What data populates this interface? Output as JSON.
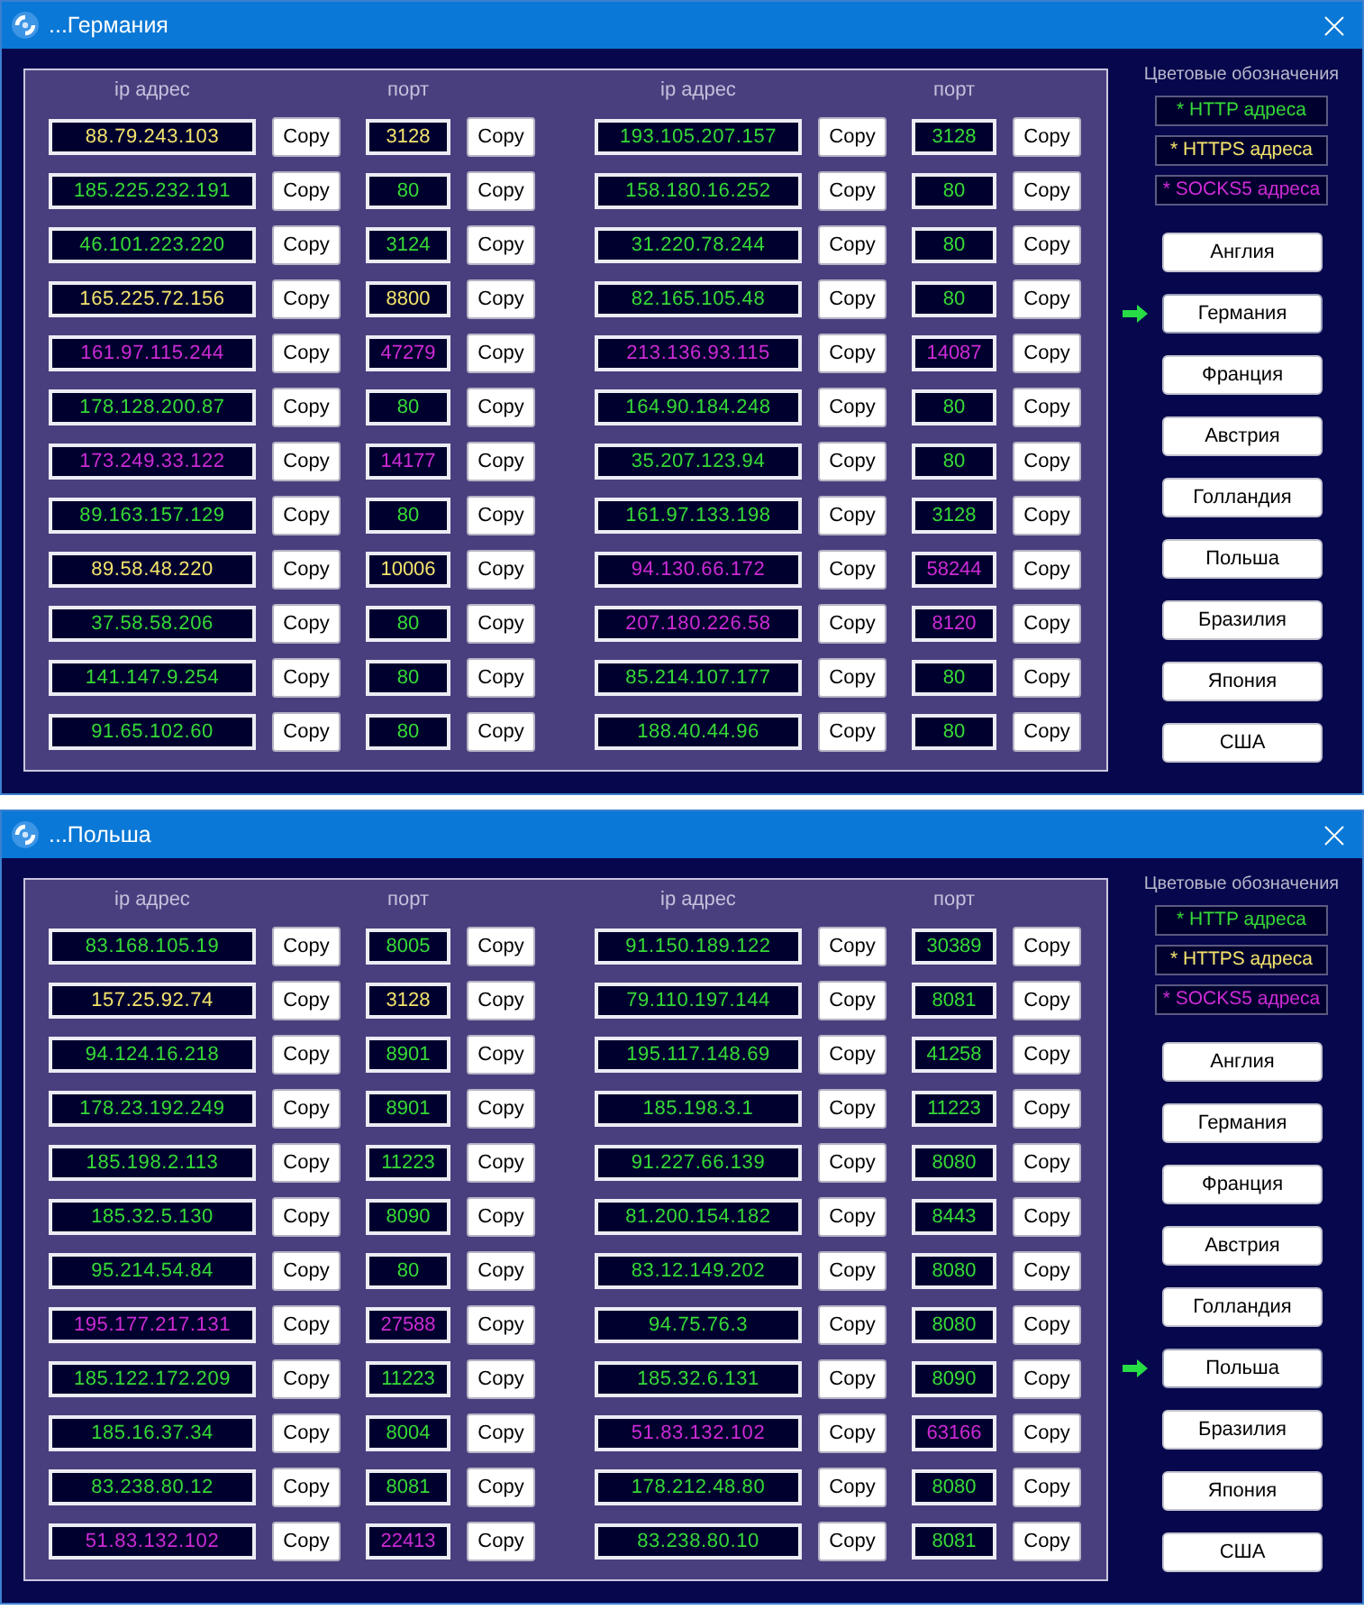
{
  "windows": [
    {
      "title": "...Германия",
      "groups": [
        {
          "ip_header": "ip адрес",
          "port_header": "порт",
          "rows": [
            {
              "ip": "88.79.243.103",
              "ip_button": "Copy",
              "port": "3128",
              "port_button": "Copy",
              "kind": "https"
            },
            {
              "ip": "185.225.232.191",
              "ip_button": "Copy",
              "port": "80",
              "port_button": "Copy",
              "kind": "http"
            },
            {
              "ip": "46.101.223.220",
              "ip_button": "Copy",
              "port": "3124",
              "port_button": "Copy",
              "kind": "http"
            },
            {
              "ip": "165.225.72.156",
              "ip_button": "Copy",
              "port": "8800",
              "port_button": "Copy",
              "kind": "https"
            },
            {
              "ip": "161.97.115.244",
              "ip_button": "Copy",
              "port": "47279",
              "port_button": "Copy",
              "kind": "socks5"
            },
            {
              "ip": "178.128.200.87",
              "ip_button": "Copy",
              "port": "80",
              "port_button": "Copy",
              "kind": "http"
            },
            {
              "ip": "173.249.33.122",
              "ip_button": "Copy",
              "port": "14177",
              "port_button": "Copy",
              "kind": "socks5"
            },
            {
              "ip": "89.163.157.129",
              "ip_button": "Copy",
              "port": "80",
              "port_button": "Copy",
              "kind": "http"
            },
            {
              "ip": "89.58.48.220",
              "ip_button": "Copy",
              "port": "10006",
              "port_button": "Copy",
              "kind": "https"
            },
            {
              "ip": "37.58.58.206",
              "ip_button": "Copy",
              "port": "80",
              "port_button": "Copy",
              "kind": "http"
            },
            {
              "ip": "141.147.9.254",
              "ip_button": "Copy",
              "port": "80",
              "port_button": "Copy",
              "kind": "http"
            },
            {
              "ip": "91.65.102.60",
              "ip_button": "Copy",
              "port": "80",
              "port_button": "Copy",
              "kind": "http"
            }
          ]
        },
        {
          "ip_header": "ip адрес",
          "port_header": "порт",
          "rows": [
            {
              "ip": "193.105.207.157",
              "ip_button": "Copy",
              "port": "3128",
              "port_button": "Copy",
              "kind": "http"
            },
            {
              "ip": "158.180.16.252",
              "ip_button": "Copy",
              "port": "80",
              "port_button": "Copy",
              "kind": "http"
            },
            {
              "ip": "31.220.78.244",
              "ip_button": "Copy",
              "port": "80",
              "port_button": "Copy",
              "kind": "http"
            },
            {
              "ip": "82.165.105.48",
              "ip_button": "Copy",
              "port": "80",
              "port_button": "Copy",
              "kind": "http"
            },
            {
              "ip": "213.136.93.115",
              "ip_button": "Copy",
              "port": "14087",
              "port_button": "Copy",
              "kind": "socks5"
            },
            {
              "ip": "164.90.184.248",
              "ip_button": "Copy",
              "port": "80",
              "port_button": "Copy",
              "kind": "http"
            },
            {
              "ip": "35.207.123.94",
              "ip_button": "Copy",
              "port": "80",
              "port_button": "Copy",
              "kind": "http"
            },
            {
              "ip": "161.97.133.198",
              "ip_button": "Copy",
              "port": "3128",
              "port_button": "Copy",
              "kind": "http"
            },
            {
              "ip": "94.130.66.172",
              "ip_button": "Copy",
              "port": "58244",
              "port_button": "Copy",
              "kind": "socks5"
            },
            {
              "ip": "207.180.226.58",
              "ip_button": "Copy",
              "port": "8120",
              "port_button": "Copy",
              "kind": "socks5"
            },
            {
              "ip": "85.214.107.177",
              "ip_button": "Copy",
              "port": "80",
              "port_button": "Copy",
              "kind": "http"
            },
            {
              "ip": "188.40.44.96",
              "ip_button": "Copy",
              "port": "80",
              "port_button": "Copy",
              "kind": "http"
            }
          ]
        }
      ],
      "legend": {
        "title": "Цветовые обозначения",
        "items": [
          {
            "label": "* HTTP адреса",
            "kind": "http"
          },
          {
            "label": "* HTTPS адреса",
            "kind": "https"
          },
          {
            "label": "* SOCKS5 адреса",
            "kind": "socks5"
          }
        ]
      },
      "countries": [
        {
          "label": "Англия",
          "selected": false
        },
        {
          "label": "Германия",
          "selected": true
        },
        {
          "label": "Франция",
          "selected": false
        },
        {
          "label": "Австрия",
          "selected": false
        },
        {
          "label": "Голландия",
          "selected": false
        },
        {
          "label": "Польша",
          "selected": false
        },
        {
          "label": "Бразилия",
          "selected": false
        },
        {
          "label": "Япония",
          "selected": false
        },
        {
          "label": "США",
          "selected": false
        }
      ]
    },
    {
      "title": "...Польша",
      "groups": [
        {
          "ip_header": "ip адрес",
          "port_header": "порт",
          "rows": [
            {
              "ip": "83.168.105.19",
              "ip_button": "Copy",
              "port": "8005",
              "port_button": "Copy",
              "kind": "http"
            },
            {
              "ip": "157.25.92.74",
              "ip_button": "Copy",
              "port": "3128",
              "port_button": "Copy",
              "kind": "https"
            },
            {
              "ip": "94.124.16.218",
              "ip_button": "Copy",
              "port": "8901",
              "port_button": "Copy",
              "kind": "http"
            },
            {
              "ip": "178.23.192.249",
              "ip_button": "Copy",
              "port": "8901",
              "port_button": "Copy",
              "kind": "http"
            },
            {
              "ip": "185.198.2.113",
              "ip_button": "Copy",
              "port": "11223",
              "port_button": "Copy",
              "kind": "http"
            },
            {
              "ip": "185.32.5.130",
              "ip_button": "Copy",
              "port": "8090",
              "port_button": "Copy",
              "kind": "http"
            },
            {
              "ip": "95.214.54.84",
              "ip_button": "Copy",
              "port": "80",
              "port_button": "Copy",
              "kind": "http"
            },
            {
              "ip": "195.177.217.131",
              "ip_button": "Copy",
              "port": "27588",
              "port_button": "Copy",
              "kind": "socks5"
            },
            {
              "ip": "185.122.172.209",
              "ip_button": "Copy",
              "port": "11223",
              "port_button": "Copy",
              "kind": "http"
            },
            {
              "ip": "185.16.37.34",
              "ip_button": "Copy",
              "port": "8004",
              "port_button": "Copy",
              "kind": "http"
            },
            {
              "ip": "83.238.80.12",
              "ip_button": "Copy",
              "port": "8081",
              "port_button": "Copy",
              "kind": "http"
            },
            {
              "ip": "51.83.132.102",
              "ip_button": "Copy",
              "port": "22413",
              "port_button": "Copy",
              "kind": "socks5"
            }
          ]
        },
        {
          "ip_header": "ip адрес",
          "port_header": "порт",
          "rows": [
            {
              "ip": "91.150.189.122",
              "ip_button": "Copy",
              "port": "30389",
              "port_button": "Copy",
              "kind": "http"
            },
            {
              "ip": "79.110.197.144",
              "ip_button": "Copy",
              "port": "8081",
              "port_button": "Copy",
              "kind": "http"
            },
            {
              "ip": "195.117.148.69",
              "ip_button": "Copy",
              "port": "41258",
              "port_button": "Copy",
              "kind": "http"
            },
            {
              "ip": "185.198.3.1",
              "ip_button": "Copy",
              "port": "11223",
              "port_button": "Copy",
              "kind": "http"
            },
            {
              "ip": "91.227.66.139",
              "ip_button": "Copy",
              "port": "8080",
              "port_button": "Copy",
              "kind": "http"
            },
            {
              "ip": "81.200.154.182",
              "ip_button": "Copy",
              "port": "8443",
              "port_button": "Copy",
              "kind": "http"
            },
            {
              "ip": "83.12.149.202",
              "ip_button": "Copy",
              "port": "8080",
              "port_button": "Copy",
              "kind": "http"
            },
            {
              "ip": "94.75.76.3",
              "ip_button": "Copy",
              "port": "8080",
              "port_button": "Copy",
              "kind": "http"
            },
            {
              "ip": "185.32.6.131",
              "ip_button": "Copy",
              "port": "8090",
              "port_button": "Copy",
              "kind": "http"
            },
            {
              "ip": "51.83.132.102",
              "ip_button": "Copy",
              "port": "63166",
              "port_button": "Copy",
              "kind": "socks5"
            },
            {
              "ip": "178.212.48.80",
              "ip_button": "Copy",
              "port": "8080",
              "port_button": "Copy",
              "kind": "http"
            },
            {
              "ip": "83.238.80.10",
              "ip_button": "Copy",
              "port": "8081",
              "port_button": "Copy",
              "kind": "http"
            }
          ]
        }
      ],
      "legend": {
        "title": "Цветовые обозначения",
        "items": [
          {
            "label": "* HTTP адреса",
            "kind": "http"
          },
          {
            "label": "* HTTPS адреса",
            "kind": "https"
          },
          {
            "label": "* SOCKS5 адреса",
            "kind": "socks5"
          }
        ]
      },
      "countries": [
        {
          "label": "Англия",
          "selected": false
        },
        {
          "label": "Германия",
          "selected": false
        },
        {
          "label": "Франция",
          "selected": false
        },
        {
          "label": "Австрия",
          "selected": false
        },
        {
          "label": "Голландия",
          "selected": false
        },
        {
          "label": "Польша",
          "selected": true
        },
        {
          "label": "Бразилия",
          "selected": false
        },
        {
          "label": "Япония",
          "selected": false
        },
        {
          "label": "США",
          "selected": false
        }
      ]
    }
  ]
}
